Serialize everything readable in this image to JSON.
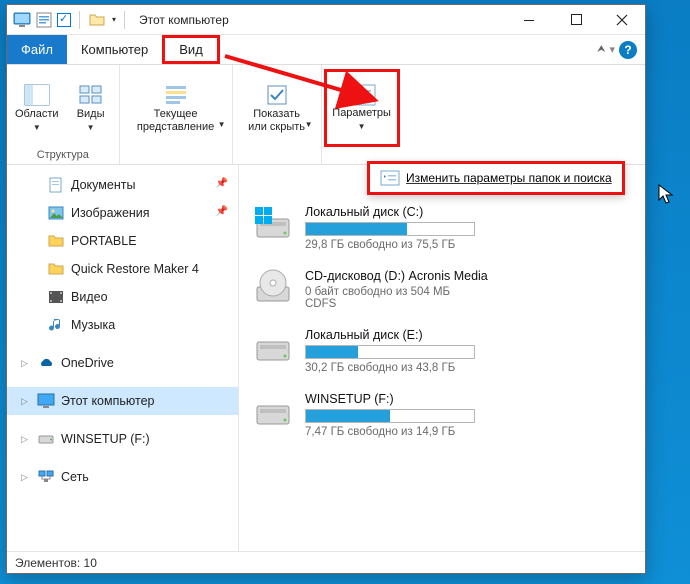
{
  "title": "Этот компьютер",
  "menu": {
    "file": "Файл",
    "computer": "Компьютер",
    "view": "Вид"
  },
  "ribbon": {
    "panes": "Области",
    "views": "Виды",
    "current_view": "Текущее\nпредставление",
    "show_hide": "Показать\nили скрыть",
    "options": "Параметры",
    "group_structure": "Структура",
    "popup": "Изменить параметры папок и поиска"
  },
  "sidebar": {
    "documents": "Документы",
    "images": "Изображения",
    "portable": "PORTABLE",
    "qrm": "Quick Restore Maker 4",
    "video": "Видео",
    "music": "Музыка",
    "onedrive": "OneDrive",
    "this_pc": "Этот компьютер",
    "winsetup": "WINSETUP (F:)",
    "network": "Сеть"
  },
  "drives": [
    {
      "name": "Локальный диск (C:)",
      "free": "29,8 ГБ свободно из 75,5 ГБ",
      "fill": 60,
      "type": "hdd"
    },
    {
      "name": "CD-дисковод (D:) Acronis Media",
      "free": "0 байт свободно из 504 МБ",
      "sub": "CDFS",
      "type": "cd"
    },
    {
      "name": "Локальный диск (E:)",
      "free": "30,2 ГБ свободно из 43,8 ГБ",
      "fill": 31,
      "type": "hdd"
    },
    {
      "name": "WINSETUP (F:)",
      "free": "7,47 ГБ свободно из 14,9 ГБ",
      "fill": 50,
      "type": "usb"
    }
  ],
  "status": "Элементов: 10"
}
